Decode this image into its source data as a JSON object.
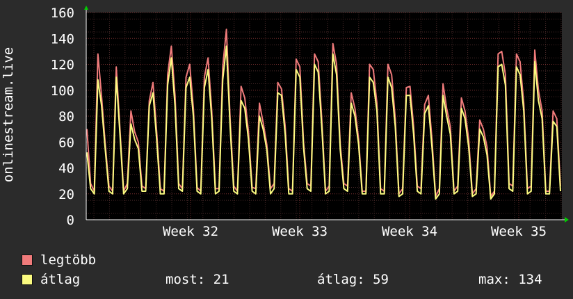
{
  "chart_data": {
    "type": "line",
    "ylabel": "onlinestream.live",
    "ylim": [
      0,
      160
    ],
    "yticks": [
      0,
      20,
      40,
      60,
      80,
      100,
      120,
      140,
      160
    ],
    "xticks": [
      "Week 32",
      "Week 33",
      "Week 34",
      "Week 35"
    ],
    "grid": true,
    "legend_position": "bottom-left",
    "series": [
      {
        "name": "legtöbb",
        "color": "#f07b7b",
        "values": [
          70,
          28,
          22,
          128,
          95,
          58,
          26,
          22,
          118,
          70,
          22,
          28,
          84,
          68,
          60,
          26,
          24,
          92,
          106,
          68,
          24,
          22,
          112,
          134,
          96,
          28,
          24,
          110,
          120,
          86,
          25,
          22,
          110,
          125,
          84,
          24,
          24,
          118,
          147,
          78,
          26,
          22,
          103,
          94,
          68,
          25,
          24,
          90,
          75,
          58,
          24,
          28,
          106,
          101,
          72,
          24,
          22,
          124,
          118,
          60,
          28,
          26,
          128,
          122,
          76,
          22,
          26,
          136,
          120,
          58,
          28,
          26,
          98,
          86,
          62,
          22,
          22,
          120,
          116,
          90,
          24,
          22,
          120,
          112,
          78,
          20,
          24,
          102,
          103,
          72,
          26,
          24,
          89,
          96,
          62,
          18,
          24,
          105,
          86,
          72,
          22,
          26,
          94,
          84,
          62,
          20,
          24,
          77,
          70,
          56,
          18,
          22,
          128,
          130,
          112,
          28,
          26,
          128,
          122,
          90,
          24,
          26,
          131,
          100,
          84,
          22,
          22,
          84,
          78,
          26
        ]
      },
      {
        "name": "átlag",
        "color": "#fbfb80",
        "values": [
          52,
          24,
          20,
          108,
          88,
          54,
          22,
          20,
          110,
          66,
          20,
          24,
          74,
          62,
          55,
          22,
          22,
          88,
          98,
          62,
          20,
          20,
          104,
          125,
          88,
          24,
          22,
          102,
          110,
          80,
          22,
          20,
          102,
          116,
          78,
          20,
          22,
          108,
          134,
          72,
          22,
          20,
          92,
          86,
          62,
          22,
          20,
          80,
          70,
          54,
          20,
          24,
          98,
          96,
          66,
          20,
          20,
          116,
          110,
          56,
          24,
          22,
          120,
          114,
          70,
          20,
          22,
          128,
          112,
          54,
          24,
          22,
          90,
          80,
          58,
          20,
          20,
          110,
          106,
          84,
          20,
          20,
          110,
          102,
          72,
          18,
          20,
          96,
          96,
          66,
          22,
          20,
          82,
          88,
          56,
          16,
          20,
          96,
          80,
          66,
          20,
          22,
          86,
          78,
          56,
          18,
          20,
          70,
          64,
          50,
          16,
          20,
          118,
          120,
          104,
          24,
          22,
          118,
          112,
          84,
          20,
          22,
          122,
          92,
          78,
          20,
          20,
          76,
          72,
          22
        ]
      }
    ]
  },
  "legend": {
    "max_label": "legtöbb",
    "avg_label": "átlag",
    "stats": [
      {
        "label": "most:",
        "value": "21"
      },
      {
        "label": "átlag:",
        "value": "59"
      },
      {
        "label": "max:",
        "value": "134"
      }
    ]
  }
}
